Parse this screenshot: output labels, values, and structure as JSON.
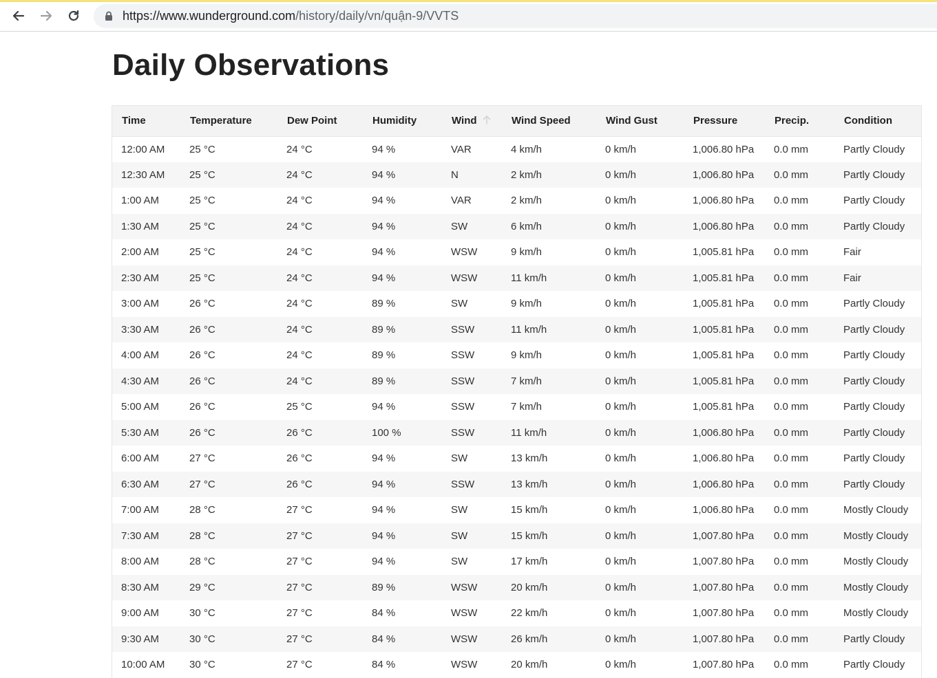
{
  "browser": {
    "url_host": "https://www.wunderground.com",
    "url_path": "/history/daily/vn/quận-9/VVTS"
  },
  "page": {
    "title": "Daily Observations"
  },
  "table": {
    "headers": [
      "Time",
      "Temperature",
      "Dew Point",
      "Humidity",
      "Wind",
      "Wind Speed",
      "Wind Gust",
      "Pressure",
      "Precip.",
      "Condition"
    ],
    "rows": [
      [
        "12:00 AM",
        "25 °C",
        "24 °C",
        "94 %",
        "VAR",
        "4 km/h",
        "0 km/h",
        "1,006.80 hPa",
        "0.0 mm",
        "Partly Cloudy"
      ],
      [
        "12:30 AM",
        "25 °C",
        "24 °C",
        "94 %",
        "N",
        "2 km/h",
        "0 km/h",
        "1,006.80 hPa",
        "0.0 mm",
        "Partly Cloudy"
      ],
      [
        "1:00 AM",
        "25 °C",
        "24 °C",
        "94 %",
        "VAR",
        "2 km/h",
        "0 km/h",
        "1,006.80 hPa",
        "0.0 mm",
        "Partly Cloudy"
      ],
      [
        "1:30 AM",
        "25 °C",
        "24 °C",
        "94 %",
        "SW",
        "6 km/h",
        "0 km/h",
        "1,006.80 hPa",
        "0.0 mm",
        "Partly Cloudy"
      ],
      [
        "2:00 AM",
        "25 °C",
        "24 °C",
        "94 %",
        "WSW",
        "9 km/h",
        "0 km/h",
        "1,005.81 hPa",
        "0.0 mm",
        "Fair"
      ],
      [
        "2:30 AM",
        "25 °C",
        "24 °C",
        "94 %",
        "WSW",
        "11 km/h",
        "0 km/h",
        "1,005.81 hPa",
        "0.0 mm",
        "Fair"
      ],
      [
        "3:00 AM",
        "26 °C",
        "24 °C",
        "89 %",
        "SW",
        "9 km/h",
        "0 km/h",
        "1,005.81 hPa",
        "0.0 mm",
        "Partly Cloudy"
      ],
      [
        "3:30 AM",
        "26 °C",
        "24 °C",
        "89 %",
        "SSW",
        "11 km/h",
        "0 km/h",
        "1,005.81 hPa",
        "0.0 mm",
        "Partly Cloudy"
      ],
      [
        "4:00 AM",
        "26 °C",
        "24 °C",
        "89 %",
        "SSW",
        "9 km/h",
        "0 km/h",
        "1,005.81 hPa",
        "0.0 mm",
        "Partly Cloudy"
      ],
      [
        "4:30 AM",
        "26 °C",
        "24 °C",
        "89 %",
        "SSW",
        "7 km/h",
        "0 km/h",
        "1,005.81 hPa",
        "0.0 mm",
        "Partly Cloudy"
      ],
      [
        "5:00 AM",
        "26 °C",
        "25 °C",
        "94 %",
        "SSW",
        "7 km/h",
        "0 km/h",
        "1,005.81 hPa",
        "0.0 mm",
        "Partly Cloudy"
      ],
      [
        "5:30 AM",
        "26 °C",
        "26 °C",
        "100 %",
        "SSW",
        "11 km/h",
        "0 km/h",
        "1,006.80 hPa",
        "0.0 mm",
        "Partly Cloudy"
      ],
      [
        "6:00 AM",
        "27 °C",
        "26 °C",
        "94 %",
        "SW",
        "13 km/h",
        "0 km/h",
        "1,006.80 hPa",
        "0.0 mm",
        "Partly Cloudy"
      ],
      [
        "6:30 AM",
        "27 °C",
        "26 °C",
        "94 %",
        "SSW",
        "13 km/h",
        "0 km/h",
        "1,006.80 hPa",
        "0.0 mm",
        "Partly Cloudy"
      ],
      [
        "7:00 AM",
        "28 °C",
        "27 °C",
        "94 %",
        "SW",
        "15 km/h",
        "0 km/h",
        "1,006.80 hPa",
        "0.0 mm",
        "Mostly Cloudy"
      ],
      [
        "7:30 AM",
        "28 °C",
        "27 °C",
        "94 %",
        "SW",
        "15 km/h",
        "0 km/h",
        "1,007.80 hPa",
        "0.0 mm",
        "Mostly Cloudy"
      ],
      [
        "8:00 AM",
        "28 °C",
        "27 °C",
        "94 %",
        "SW",
        "17 km/h",
        "0 km/h",
        "1,007.80 hPa",
        "0.0 mm",
        "Mostly Cloudy"
      ],
      [
        "8:30 AM",
        "29 °C",
        "27 °C",
        "89 %",
        "WSW",
        "20 km/h",
        "0 km/h",
        "1,007.80 hPa",
        "0.0 mm",
        "Mostly Cloudy"
      ],
      [
        "9:00 AM",
        "30 °C",
        "27 °C",
        "84 %",
        "WSW",
        "22 km/h",
        "0 km/h",
        "1,007.80 hPa",
        "0.0 mm",
        "Mostly Cloudy"
      ],
      [
        "9:30 AM",
        "30 °C",
        "27 °C",
        "84 %",
        "WSW",
        "26 km/h",
        "0 km/h",
        "1,007.80 hPa",
        "0.0 mm",
        "Partly Cloudy"
      ],
      [
        "10:00 AM",
        "30 °C",
        "27 °C",
        "84 %",
        "WSW",
        "20 km/h",
        "0 km/h",
        "1,007.80 hPa",
        "0.0 mm",
        "Partly Cloudy"
      ]
    ]
  }
}
